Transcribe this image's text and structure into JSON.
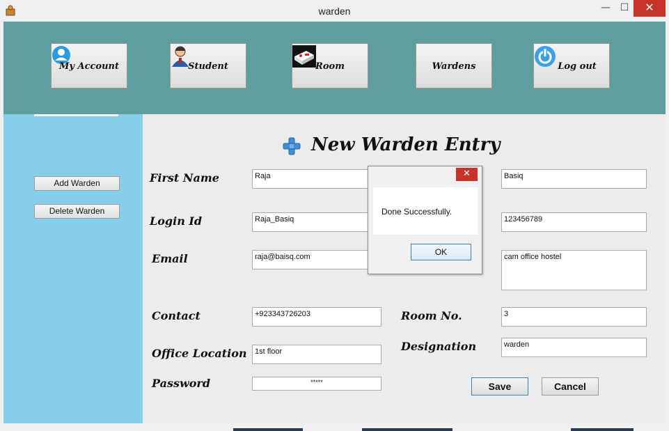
{
  "window": {
    "title": "warden",
    "minimize_glyph": "—",
    "maximize_glyph": "☐",
    "close_glyph": "✕"
  },
  "nav": {
    "items": [
      {
        "label": "My Account",
        "icon": "user-circle-icon"
      },
      {
        "label": "Student",
        "icon": "student-icon"
      },
      {
        "label": "Room",
        "icon": "room-icon"
      },
      {
        "label": "Wardens",
        "icon": ""
      },
      {
        "label": "Log out",
        "icon": "power-icon"
      }
    ]
  },
  "sidebar": {
    "add_label": "Add Warden",
    "delete_label": "Delete Warden"
  },
  "form": {
    "title": "New Warden Entry",
    "labels": {
      "first_name": "First Name",
      "login_id": "Login Id",
      "email": "Email",
      "contact": "Contact",
      "office_location": "Office Location",
      "password": "Password",
      "room_no": "Room No.",
      "designation": "Designation"
    },
    "values": {
      "first_name": "Raja",
      "last_name": "Basiq",
      "login_id": "Raja_Basiq",
      "login_right": "123456789",
      "email": "raja@baisq.com",
      "address": "cam office hostel",
      "contact": "+923343726203",
      "office_location": "1st floor",
      "password": "*****",
      "room_no": "3",
      "designation": "warden"
    },
    "save_label": "Save",
    "cancel_label": "Cancel"
  },
  "dialog": {
    "message": "Done Successfully.",
    "ok_label": "OK",
    "close_glyph": "✕"
  },
  "colors": {
    "header_bg": "#5f9e9e",
    "sidebar_bg": "#87ceeb",
    "close_red": "#c7322a"
  }
}
